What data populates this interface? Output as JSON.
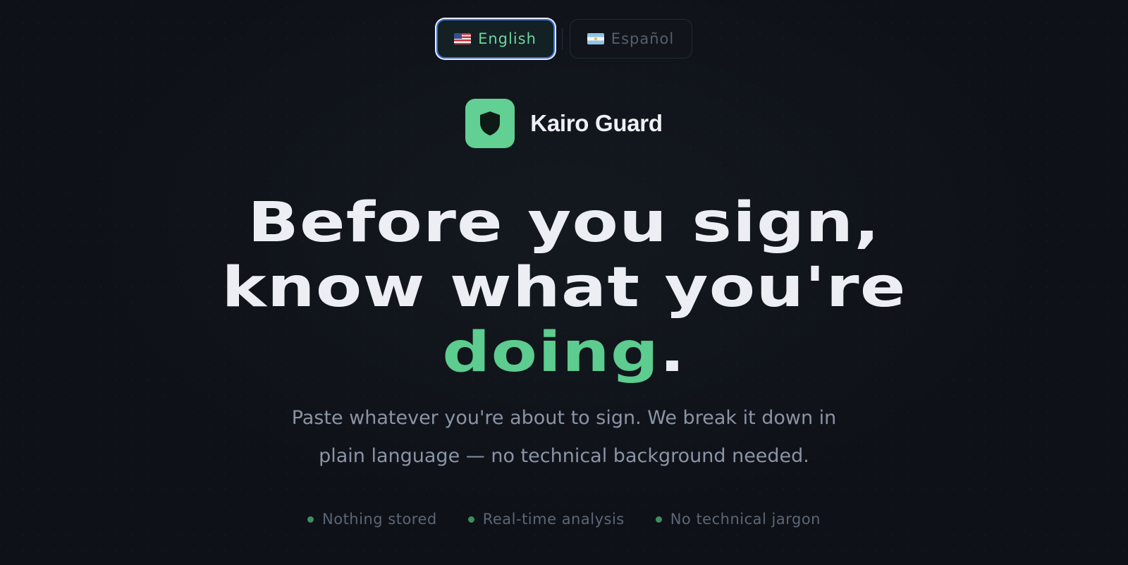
{
  "language_switcher": {
    "english": {
      "label": "English",
      "flag_icon": "us-flag-icon",
      "active": true
    },
    "spanish": {
      "label": "Español",
      "flag_icon": "argentina-flag-icon",
      "active": false
    }
  },
  "brand": {
    "name": "Kairo Guard",
    "logo_icon": "shield-icon"
  },
  "hero": {
    "line1": "Before you sign,",
    "line2": "know what you're",
    "line3_accent": "doing",
    "line3_end": "."
  },
  "subtitle": {
    "line1": "Paste whatever you're about to sign. We break it down in",
    "line2": "plain language — no technical background needed."
  },
  "features": [
    {
      "label": "Nothing stored"
    },
    {
      "label": "Real-time analysis"
    },
    {
      "label": "No technical jargon"
    }
  ],
  "colors": {
    "background": "#0e1117",
    "accent": "#5ccc8f",
    "active_border": "#3b6fd8",
    "headline": "#eceef4",
    "muted": "#8a94a6"
  }
}
